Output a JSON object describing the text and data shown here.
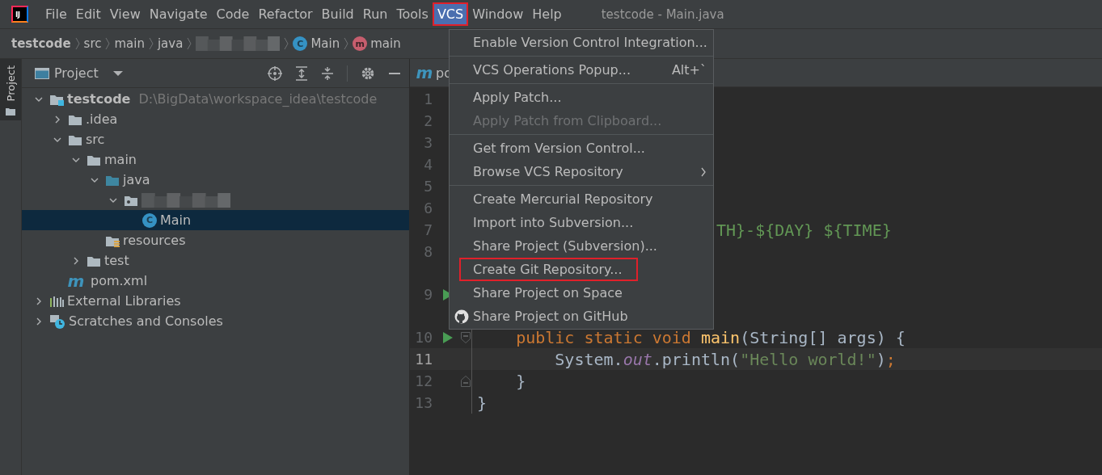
{
  "menu_bar": {
    "logo": {
      "glyph": "IJ"
    },
    "menus": [
      {
        "label": "File",
        "selected": false,
        "outlined": false
      },
      {
        "label": "Edit",
        "selected": false,
        "outlined": false
      },
      {
        "label": "View",
        "selected": false,
        "outlined": false
      },
      {
        "label": "Navigate",
        "selected": false,
        "outlined": false
      },
      {
        "label": "Code",
        "selected": false,
        "outlined": false
      },
      {
        "label": "Refactor",
        "selected": false,
        "outlined": false
      },
      {
        "label": "Build",
        "selected": false,
        "outlined": false
      },
      {
        "label": "Run",
        "selected": false,
        "outlined": false
      },
      {
        "label": "Tools",
        "selected": false,
        "outlined": false
      },
      {
        "label": "VCS",
        "selected": true,
        "outlined": true
      },
      {
        "label": "Window",
        "selected": false,
        "outlined": false
      },
      {
        "label": "Help",
        "selected": false,
        "outlined": false
      }
    ],
    "title": "testcode - Main.java"
  },
  "breadcrumbs": [
    {
      "kind": "root",
      "label": "testcode"
    },
    {
      "kind": "folder",
      "label": "src"
    },
    {
      "kind": "folder",
      "label": "main"
    },
    {
      "kind": "folder",
      "label": "java"
    },
    {
      "kind": "redacted"
    },
    {
      "kind": "class",
      "label": "Main",
      "glyph": "C"
    },
    {
      "kind": "method",
      "label": "main",
      "glyph": "m"
    }
  ],
  "tool_stripe": {
    "tabs": [
      {
        "label": "Project",
        "selected": true
      }
    ]
  },
  "project_panel": {
    "title": "Project",
    "tree": [
      {
        "kind": "module",
        "label": "testcode",
        "path": "D:\\BigData\\workspace_idea\\testcode",
        "expanded": true,
        "selected": false,
        "children": [
          {
            "kind": "folder",
            "label": ".idea",
            "expanded": false,
            "selected": false
          },
          {
            "kind": "folder",
            "label": "src",
            "expanded": true,
            "selected": false,
            "children": [
              {
                "kind": "folder",
                "label": "main",
                "expanded": true,
                "selected": false,
                "children": [
                  {
                    "kind": "source",
                    "label": "java",
                    "expanded": true,
                    "selected": false,
                    "children": [
                      {
                        "kind": "redacted",
                        "expanded": true,
                        "selected": false,
                        "children": [
                          {
                            "kind": "class",
                            "label": "Main",
                            "glyph": "C",
                            "selected": true
                          }
                        ]
                      }
                    ]
                  },
                  {
                    "kind": "resources",
                    "label": "resources",
                    "selected": false
                  }
                ]
              },
              {
                "kind": "folder",
                "label": "test",
                "expanded": false,
                "selected": false
              }
            ]
          },
          {
            "kind": "maven",
            "label": "pom.xml",
            "glyph": "m",
            "selected": false
          }
        ]
      },
      {
        "kind": "libraries",
        "label": "External Libraries",
        "expanded": false,
        "selected": false
      },
      {
        "kind": "scratches",
        "label": "Scratches and Consoles",
        "expanded": false,
        "selected": false
      }
    ]
  },
  "editor": {
    "tabs": [
      {
        "label": "po",
        "glyph": "m"
      }
    ],
    "lines": [
      {
        "number": "1",
        "run": false,
        "current": false
      },
      {
        "number": "2",
        "run": false,
        "current": false
      },
      {
        "number": "3",
        "run": false,
        "current": false
      },
      {
        "number": "4",
        "run": false,
        "current": false
      },
      {
        "number": "5",
        "run": false,
        "current": false
      },
      {
        "number": "6",
        "run": false,
        "current": false
      },
      {
        "number": "7",
        "run": false,
        "current": false,
        "tokens": [
          {
            "kind": "doc",
            "text": "TH}-${DAY} ${TIME}"
          }
        ]
      },
      {
        "number": "8",
        "run": false,
        "current": false
      },
      {
        "number": "9",
        "run": true,
        "current": false
      },
      {
        "number": "10",
        "kind": "fold-start",
        "run": true,
        "current": false,
        "tokens": [
          {
            "kind": "keyword",
            "text": "    public static void "
          },
          {
            "kind": "method",
            "text": "main"
          },
          {
            "kind": "plain",
            "text": "(String[] args) {"
          }
        ]
      },
      {
        "number": "11",
        "run": false,
        "current": true,
        "tokens": [
          {
            "kind": "plain",
            "text": "        System."
          },
          {
            "kind": "field",
            "text": "out"
          },
          {
            "kind": "plain",
            "text": ".println("
          },
          {
            "kind": "string",
            "text": "\"Hello world!\""
          },
          {
            "kind": "plain",
            "text": ")"
          },
          {
            "kind": "keyword",
            "text": ";"
          }
        ]
      },
      {
        "number": "12",
        "kind": "fold-end",
        "run": false,
        "current": false,
        "tokens": [
          {
            "kind": "plain",
            "text": "    }"
          }
        ]
      },
      {
        "number": "13",
        "run": false,
        "current": false,
        "tokens": [
          {
            "kind": "plain",
            "text": "}"
          }
        ]
      }
    ]
  },
  "vcs_menu": {
    "groups": [
      [
        {
          "kind": "plain",
          "label": "Enable Version Control Integration...",
          "disabled": false,
          "outlined": false
        }
      ],
      [
        {
          "kind": "plain",
          "label": "VCS Operations Popup...",
          "shortcut": "Alt+`",
          "disabled": false,
          "outlined": false
        }
      ],
      [
        {
          "kind": "plain",
          "label": "Apply Patch...",
          "disabled": false,
          "outlined": false
        },
        {
          "kind": "plain",
          "label": "Apply Patch from Clipboard...",
          "disabled": true,
          "outlined": false
        }
      ],
      [
        {
          "kind": "plain",
          "label": "Get from Version Control...",
          "disabled": false,
          "outlined": false
        },
        {
          "kind": "submenu",
          "label": "Browse VCS Repository",
          "disabled": false,
          "outlined": false
        }
      ],
      [
        {
          "kind": "plain",
          "label": "Create Mercurial Repository",
          "disabled": false,
          "outlined": false
        },
        {
          "kind": "plain",
          "label": "Import into Subversion...",
          "disabled": false,
          "outlined": false
        },
        {
          "kind": "plain",
          "label": "Share Project (Subversion)...",
          "disabled": false,
          "outlined": false
        },
        {
          "kind": "plain",
          "label": "Create Git Repository...",
          "disabled": false,
          "outlined": true
        },
        {
          "kind": "plain",
          "label": "Share Project on Space",
          "disabled": false,
          "outlined": false
        },
        {
          "kind": "github",
          "label": "Share Project on GitHub",
          "disabled": false,
          "outlined": false
        }
      ]
    ]
  }
}
